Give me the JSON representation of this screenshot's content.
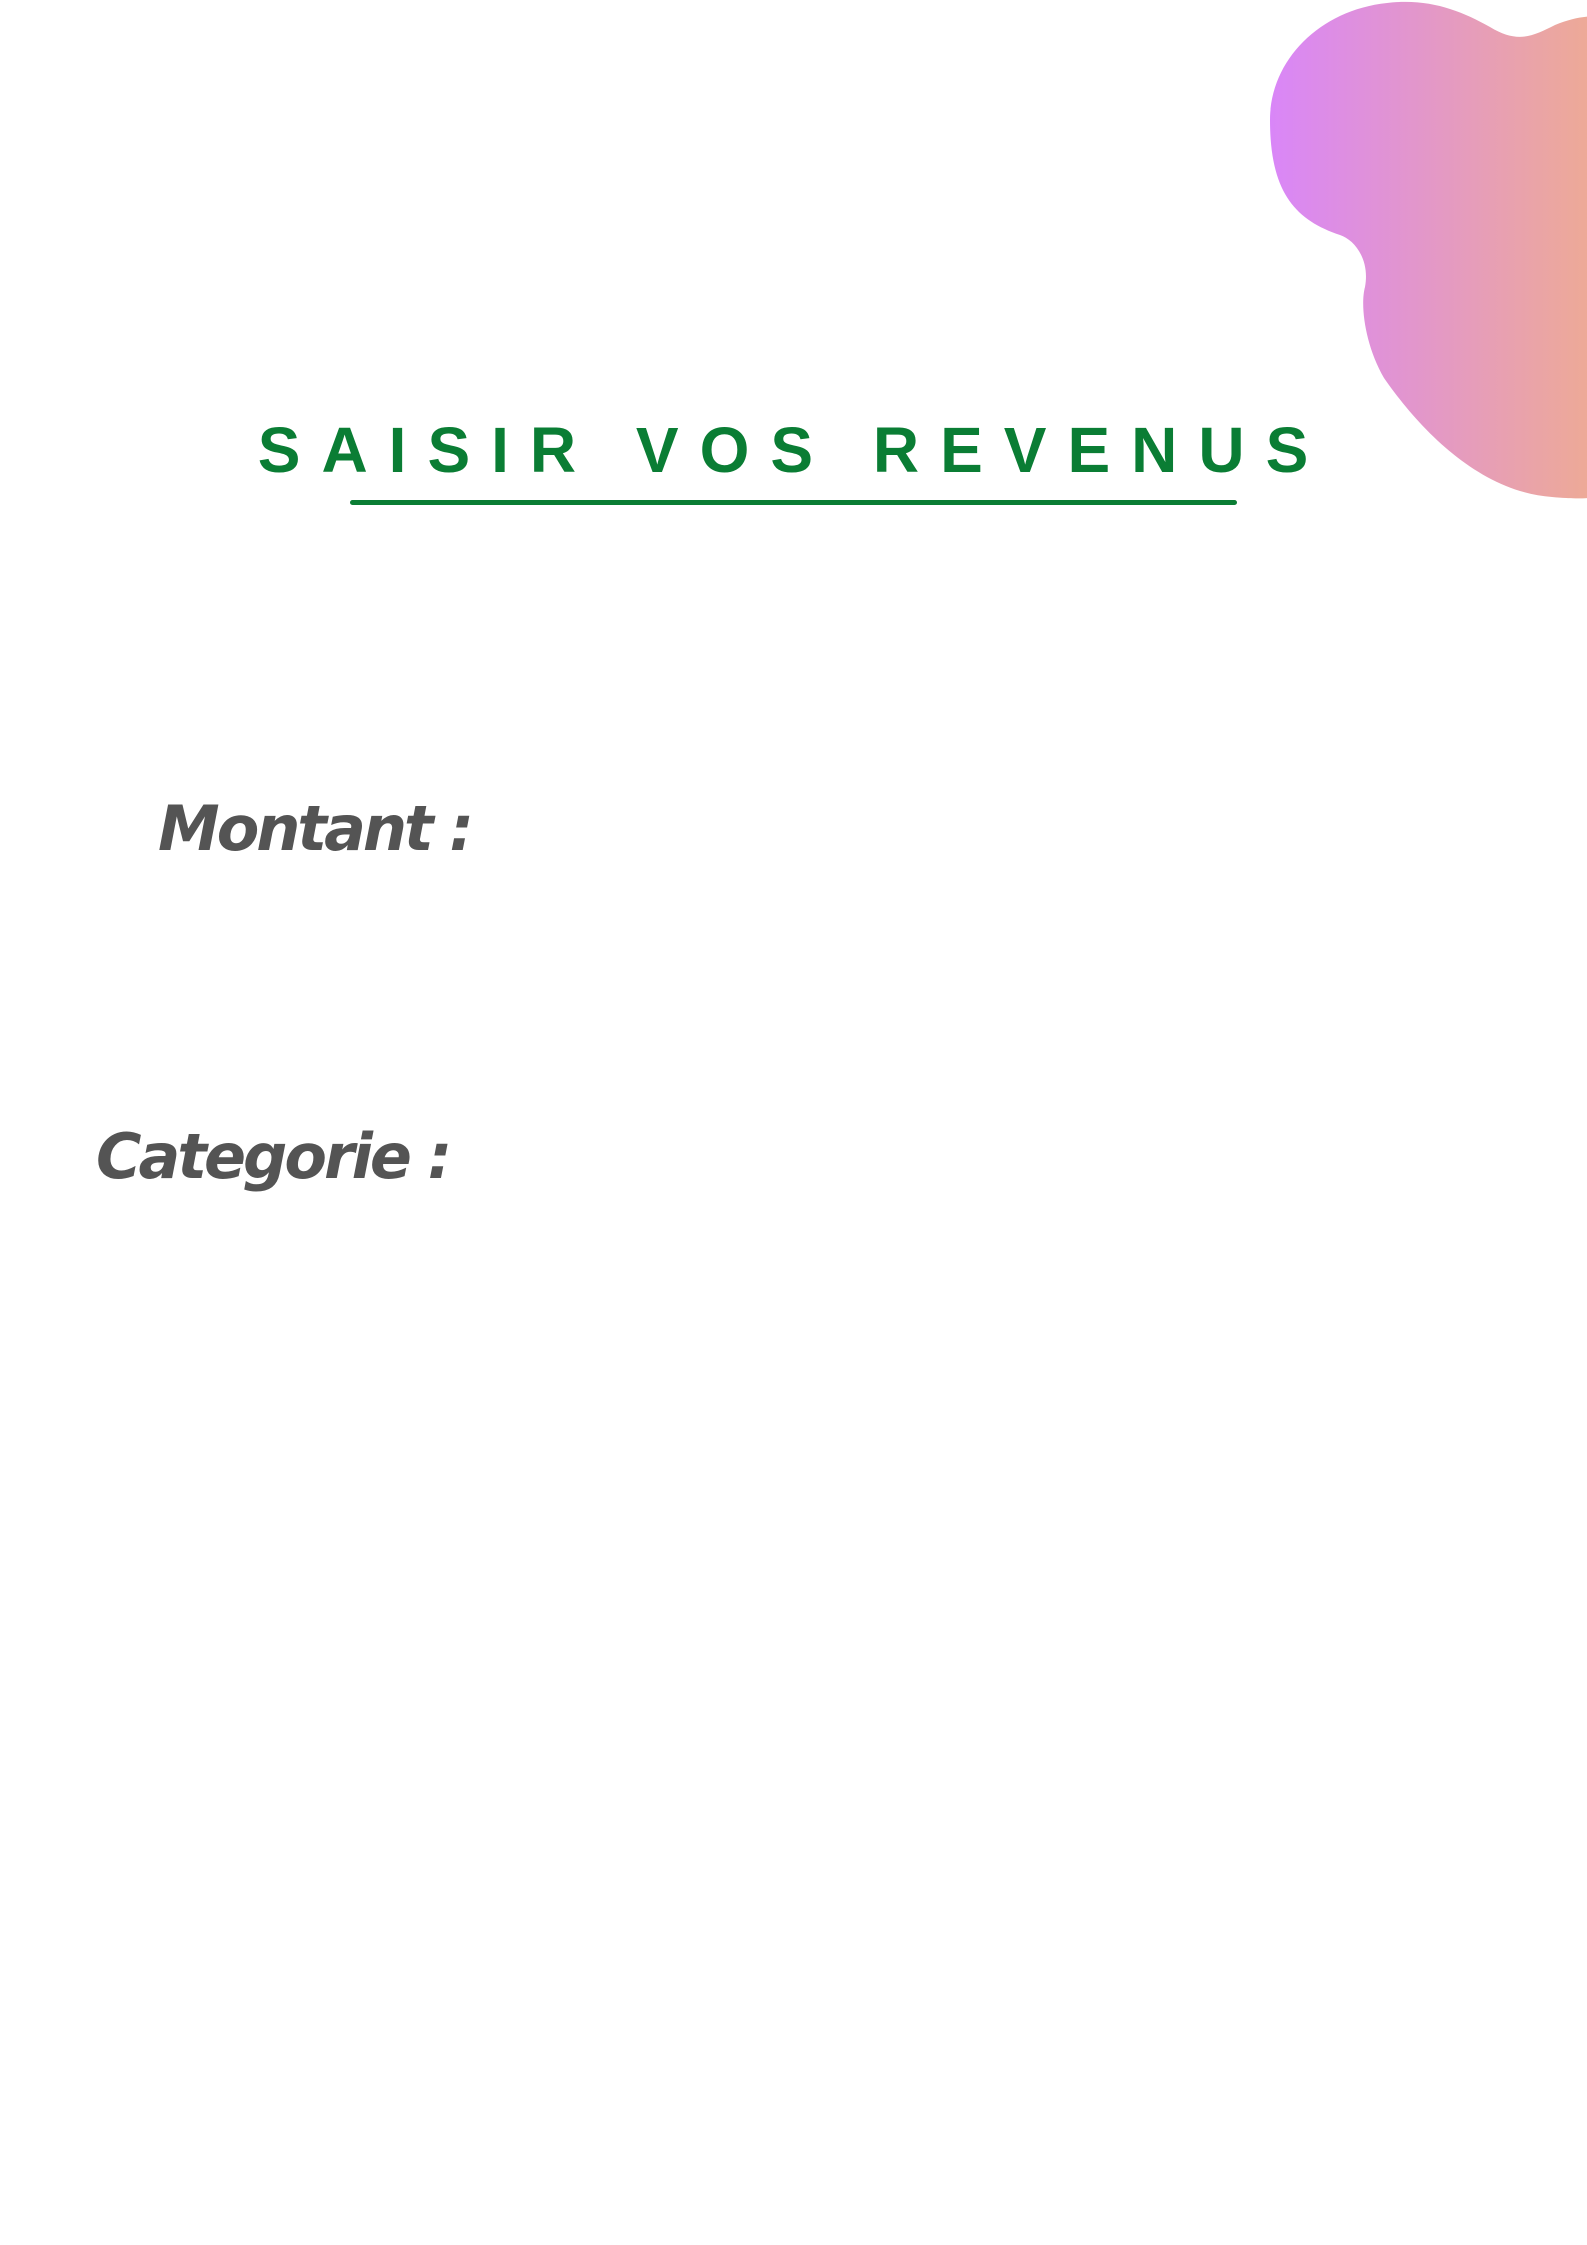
{
  "page": {
    "title": "SAISIR VOS REVENUS"
  },
  "form": {
    "amount_label": "Montant :",
    "category_label": "Categorie :"
  },
  "colors": {
    "title": "#0a7d34",
    "label": "#545454",
    "blob_gradient_start": "#d986f8",
    "blob_gradient_end": "#eeab93"
  },
  "decoration": {
    "blob": "gradient-blob-shape"
  }
}
